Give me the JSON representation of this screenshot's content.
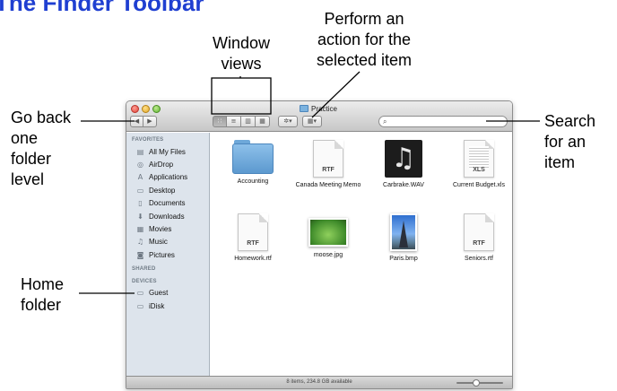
{
  "heading": "The Finder Toolbar",
  "annotations": {
    "go_back": [
      "Go back",
      "one",
      "folder",
      "level"
    ],
    "window_views": [
      "Window",
      "views"
    ],
    "perform_action": [
      "Perform an",
      "action for the",
      "selected item"
    ],
    "search": [
      "Search",
      "for an",
      "item"
    ],
    "home_folder": [
      "Home",
      "folder"
    ]
  },
  "window": {
    "title": "Practice",
    "toolbar": {
      "back": "◀",
      "forward": "▶",
      "view_icon": "∷",
      "view_list": "≡",
      "view_column": "▥",
      "view_coverflow": "▦",
      "action": "✲▾",
      "arrange": "▦▾",
      "search_icon": "⌕",
      "search_value": ""
    },
    "sidebar": {
      "favorites_header": "FAVORITES",
      "favorites": [
        {
          "label": "All My Files",
          "icon": "all-files-icon",
          "glyph": "▤"
        },
        {
          "label": "AirDrop",
          "icon": "airdrop-icon",
          "glyph": "◎"
        },
        {
          "label": "Applications",
          "icon": "applications-icon",
          "glyph": "A"
        },
        {
          "label": "Desktop",
          "icon": "desktop-icon",
          "glyph": "▭"
        },
        {
          "label": "Documents",
          "icon": "documents-icon",
          "glyph": "▯"
        },
        {
          "label": "Downloads",
          "icon": "downloads-icon",
          "glyph": "⬇"
        },
        {
          "label": "Movies",
          "icon": "movies-icon",
          "glyph": "▦"
        },
        {
          "label": "Music",
          "icon": "music-icon",
          "glyph": "♫"
        },
        {
          "label": "Pictures",
          "icon": "pictures-icon",
          "glyph": "◙"
        }
      ],
      "shared_header": "SHARED",
      "devices_header": "DEVICES",
      "devices": [
        {
          "label": "Guest",
          "icon": "home-icon",
          "glyph": "▭"
        },
        {
          "label": "iDisk",
          "icon": "idisk-icon",
          "glyph": "▭"
        }
      ]
    },
    "files": [
      {
        "name": "Accounting",
        "kind": "folder"
      },
      {
        "name": "Canada Meeting Memo",
        "kind": "doc",
        "ext": "RTF"
      },
      {
        "name": "Carbrake.WAV",
        "kind": "music"
      },
      {
        "name": "Current Budget.xls",
        "kind": "sheet",
        "ext": "XLS"
      },
      {
        "name": "Homework.rtf",
        "kind": "doc",
        "ext": "RTF"
      },
      {
        "name": "moose.jpg",
        "kind": "photo"
      },
      {
        "name": "Paris.bmp",
        "kind": "paris"
      },
      {
        "name": "Seniors.rtf",
        "kind": "doc",
        "ext": "RTF"
      }
    ],
    "status": "8 items, 234.8 GB available"
  }
}
